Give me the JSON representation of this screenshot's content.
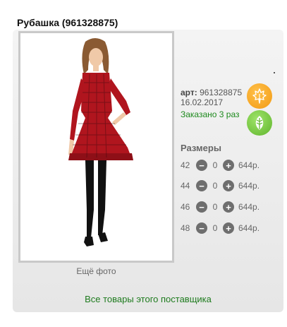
{
  "product": {
    "title": "Рубашка (961328875)",
    "article_label": "арт:",
    "article_value": "961328875",
    "date": "16.02.2017",
    "ordered": "Заказано 3 раз",
    "more_photo": "Ещё фото",
    "supplier_link": "Все товары этого поставщика"
  },
  "sizes": {
    "title": "Размеры",
    "minus_symbol": "−",
    "plus_symbol": "+",
    "rows": [
      {
        "size": "42",
        "qty": "0",
        "price": "644р."
      },
      {
        "size": "44",
        "qty": "0",
        "price": "644р."
      },
      {
        "size": "46",
        "qty": "0",
        "price": "644р."
      },
      {
        "size": "48",
        "qty": "0",
        "price": "644р."
      }
    ]
  },
  "badges": {
    "orange": {
      "icon": "maple-leaf-icon",
      "color": "#f5a623"
    },
    "green": {
      "icon": "leaf-icon",
      "color": "#6cc136"
    }
  },
  "colors": {
    "accent_green": "#1e7b1e",
    "dress_red": "#b0151e"
  }
}
